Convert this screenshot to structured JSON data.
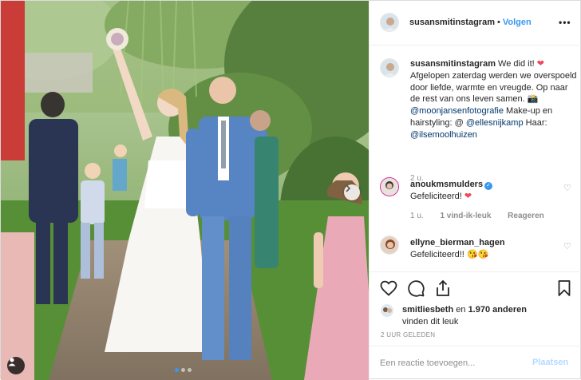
{
  "post_author": {
    "username": "susansmitinstagram",
    "follow_label": "Volgen"
  },
  "caption": {
    "username": "susansmitinstagram",
    "text_1": "We did it!",
    "text_2": "Afgelopen zaterdag werden we overspoeld door liefde, warmte en vreugde. Op naar de rest van ons leven samen.",
    "mention_1": "@moonjansenfotografie",
    "text_3": "Make-up en hairstyling: @",
    "mention_2": "@ellesnijkamp",
    "text_4": "Haar:",
    "mention_3": "@ilsemoolhuizen",
    "time": "2 u."
  },
  "comments": [
    {
      "username": "anoukmsmulders",
      "text": "Gefeliciteerd!",
      "time": "1 u.",
      "likes": "1 vind-ik-leuk",
      "reply_label": "Reageren"
    },
    {
      "username": "ellyne_bierman_hagen",
      "text": "Gefeliciteerd!!"
    }
  ],
  "likes": {
    "liker": "smitliesbeth",
    "text_middle": "en",
    "others": "1.970 anderen",
    "text_end": "vinden dit leuk"
  },
  "timestamp": "2 UUR GELEDEN",
  "comment_input": {
    "placeholder": "Een reactie toevoegen...",
    "post_label": "Plaatsen"
  },
  "icons": {
    "carousel_next": "chevron-right-icon",
    "tag": "user-tag-icon",
    "like": "heart-icon",
    "comment": "comment-icon",
    "share": "share-icon",
    "save": "bookmark-icon",
    "more": "more-options-icon",
    "verified": "verified-badge-icon"
  },
  "colors": {
    "link_blue": "#3897f0",
    "mention": "#00376b",
    "heart": "#ed4956",
    "muted": "#8e8e8e",
    "post_disabled": "#b3dbff"
  },
  "carousel": {
    "current": 1,
    "total": 3
  }
}
